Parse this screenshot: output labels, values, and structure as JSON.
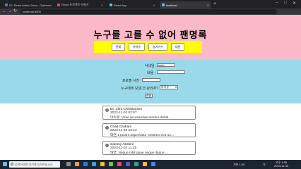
{
  "browser": {
    "tabs": [
      {
        "label": "09. React Admin Dass - Optimum",
        "color": "#4a7fd8"
      },
      {
        "label": "React 프로젝트 만들기",
        "color": "#e0533a"
      },
      {
        "label": "React App",
        "color": "#5fc1e6"
      },
      {
        "label": "localhost",
        "color": "#5fc1e6"
      }
    ],
    "new_tab": "+",
    "window_controls": [
      "–",
      "□",
      "✕"
    ],
    "nav_buttons": [
      "←",
      "→",
      "↻"
    ],
    "url": "localhost:3000"
  },
  "page": {
    "title": "누구를 고를 수 없어 팬명록",
    "nav_buttons": [
      "전체",
      "아이유",
      "슬기가수",
      "태연"
    ],
    "form": {
      "name_label": "닉네임:",
      "name_value": "hello",
      "content_label": "내용 :",
      "profile_label": "프로필 사진 :",
      "select_label": "누구에게 보낼 건 관리자?",
      "select_value": "아이유",
      "submit_label": "전송"
    },
    "comments": [
      {
        "name": "Dr. Clint Christiansen",
        "date": "2023-11-02 02:07",
        "message": "아이유: Vitae recusandae tenetur debiti..."
      },
      {
        "name": "Chad Graham",
        "date": "2023-11-02 23:13",
        "message": "태연 1 Ipsam aspernatur nostrum eos un..."
      },
      {
        "name": "Sammy Abshire",
        "date": "2023-11-02 11:25",
        "message": "태연: Neque nihil quae neque itaque ..."
      }
    ]
  },
  "taskbar": {
    "search_placeholder": "검색하려면 여기에 입력하십시오.",
    "weather": "기온 1:00",
    "time": "오후 1:55",
    "date": "2023-11-05",
    "lang": "가"
  }
}
